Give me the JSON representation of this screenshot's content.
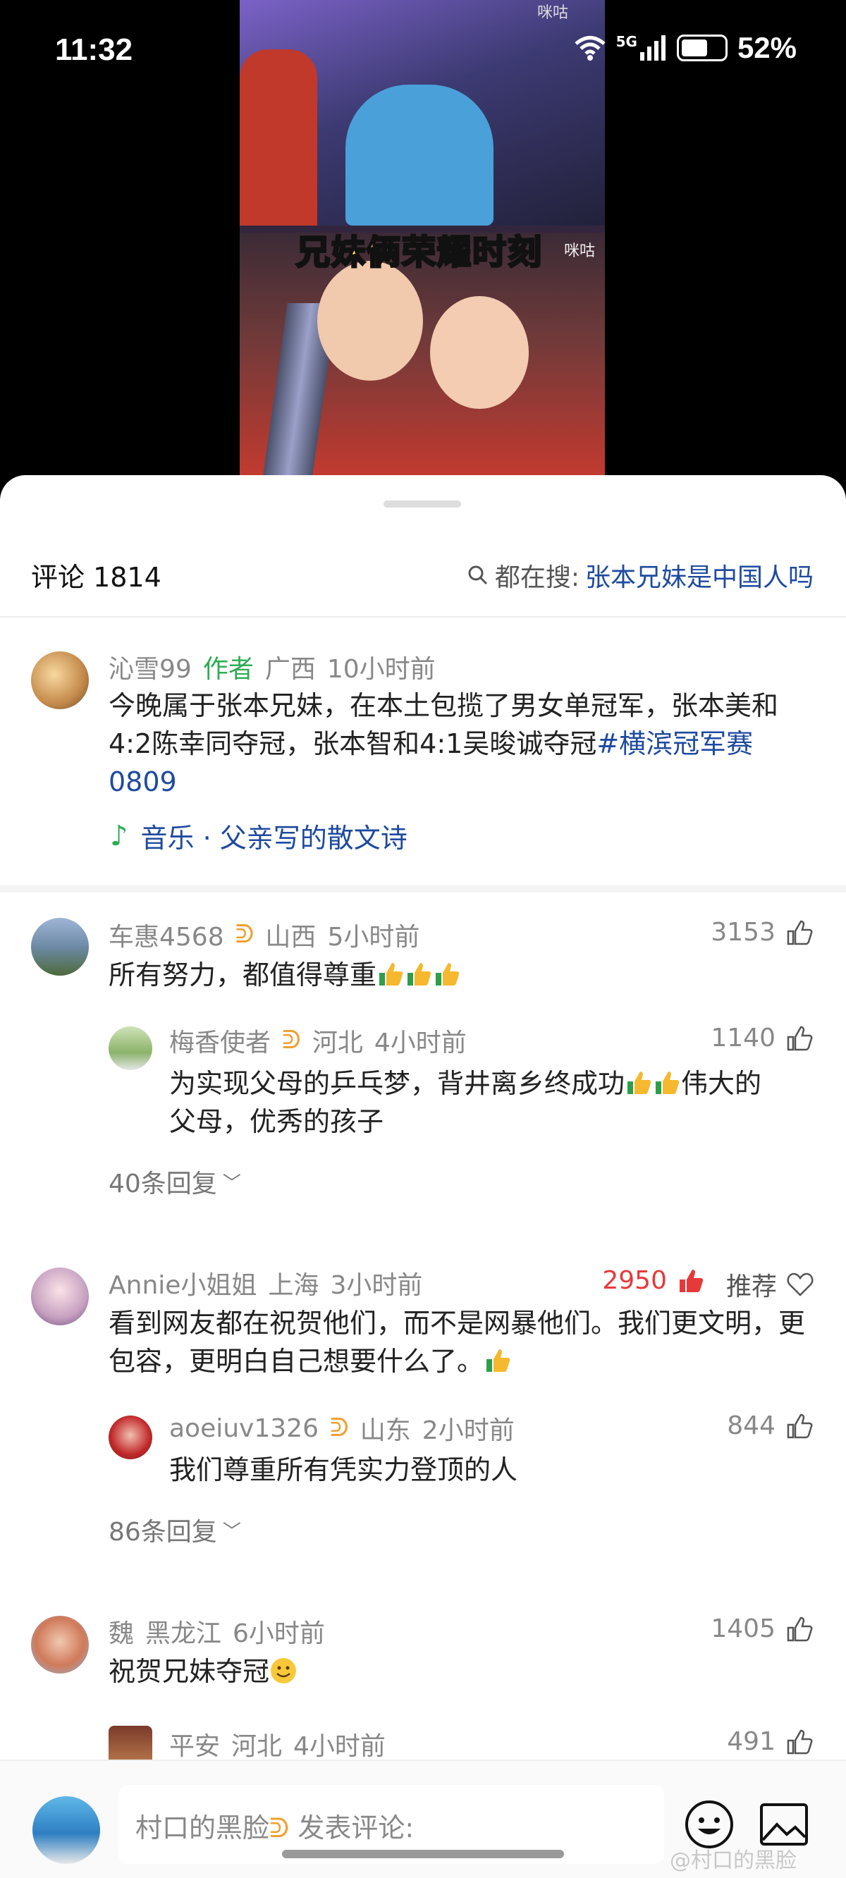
{
  "status_bar": {
    "time": "11:32",
    "network": "5G",
    "battery": "52%"
  },
  "video": {
    "caption": "兄妹俩荣耀时刻",
    "watermark": "咪咕"
  },
  "header": {
    "title": "评论 1814",
    "search_prefix": "都在搜:",
    "search_keyword": "张本兄妹是中国人吗"
  },
  "post": {
    "user": "沁雪99",
    "badge": "作者",
    "location": "广西",
    "time": "10小时前",
    "text": "今晚属于张本兄妹，在本土包揽了男女单冠军，张本美和4:2陈幸同夺冠，张本智和4:1吴晙诚夺冠",
    "hashtag": "#横滨冠军赛0809",
    "music": "音乐 · 父亲写的散文诗"
  },
  "comments": [
    {
      "user": "车惠4568",
      "location": "山西",
      "time": "5小时前",
      "likes": "3153",
      "text": "所有努力，都值得尊重",
      "reply": {
        "user": "梅香使者",
        "location": "河北",
        "time": "4小时前",
        "likes": "1140",
        "text1": "为实现父母的乒乓梦，背井离乡终成功",
        "text2": "伟大的",
        "text3": "父母，优秀的孩子"
      },
      "more": "40条回复"
    },
    {
      "user": "Annie小姐姐",
      "location": "上海",
      "time": "3小时前",
      "likes": "2950",
      "recommend": "推荐",
      "text": "看到网友都在祝贺他们，而不是网暴他们。我们更文明，更包容，更明白自己想要什么了。",
      "reply": {
        "user": "aoeiuv1326",
        "location": "山东",
        "time": "2小时前",
        "likes": "844",
        "text1": "我们尊重所有凭实力登顶的人"
      },
      "more": "86条回复"
    },
    {
      "user": "魏",
      "location": "黑龙江",
      "time": "6小时前",
      "likes": "1405",
      "text": "祝贺兄妹夺冠",
      "reply": {
        "user": "平安",
        "location": "河北",
        "time": "4小时前",
        "likes": "491"
      }
    }
  ],
  "bottom": {
    "placeholder_user": "村口的黑脸",
    "placeholder_suffix": "发表评论:",
    "watermark": "@村口的黑脸"
  },
  "colors": {
    "accent_blue": "#1e4aa0",
    "author_green": "#2eac54",
    "hot_red": "#e8393a"
  }
}
